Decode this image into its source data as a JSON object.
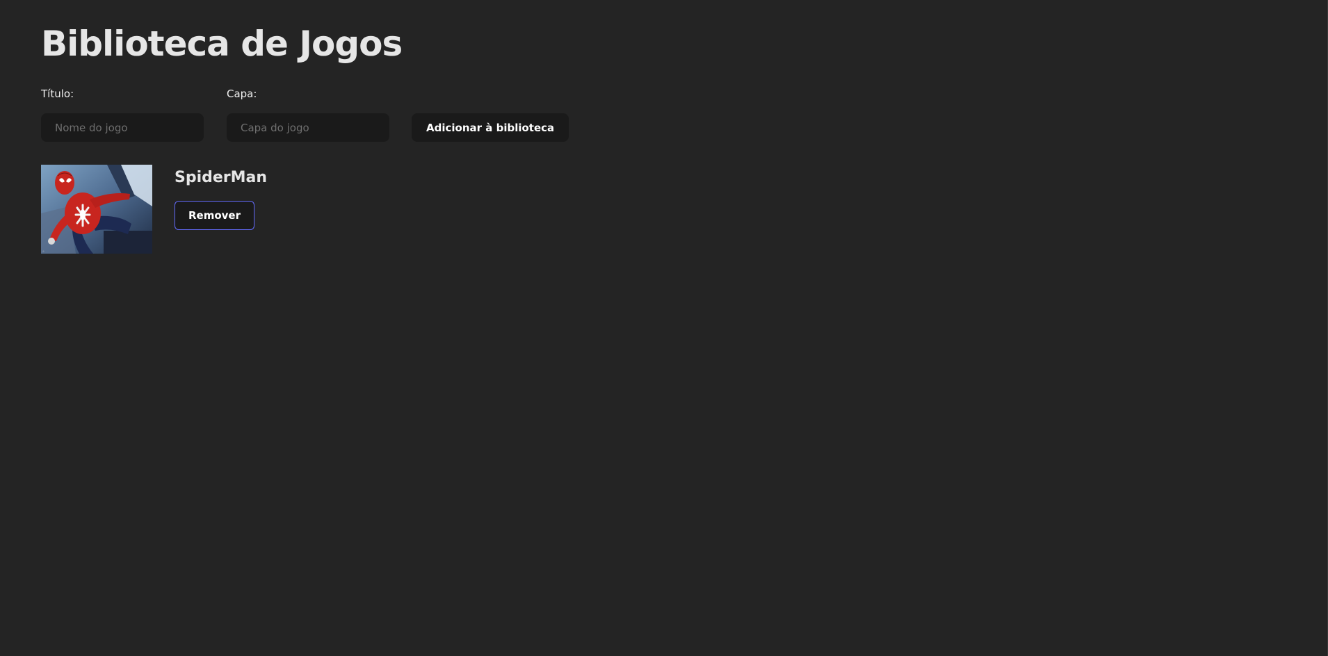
{
  "header": {
    "title": "Biblioteca de Jogos"
  },
  "form": {
    "title_label": "Título:",
    "title_placeholder": "Nome do jogo",
    "title_value": "",
    "cover_label": "Capa:",
    "cover_placeholder": "Capa do jogo",
    "cover_value": "",
    "add_button_label": "Adicionar à biblioteca"
  },
  "games": [
    {
      "title": "SpiderMan",
      "remove_label": "Remover",
      "cover_icon": "spiderman-cover-image"
    }
  ],
  "colors": {
    "background": "#242424",
    "input_background": "#1a1a1a",
    "accent_border": "#646cff"
  }
}
